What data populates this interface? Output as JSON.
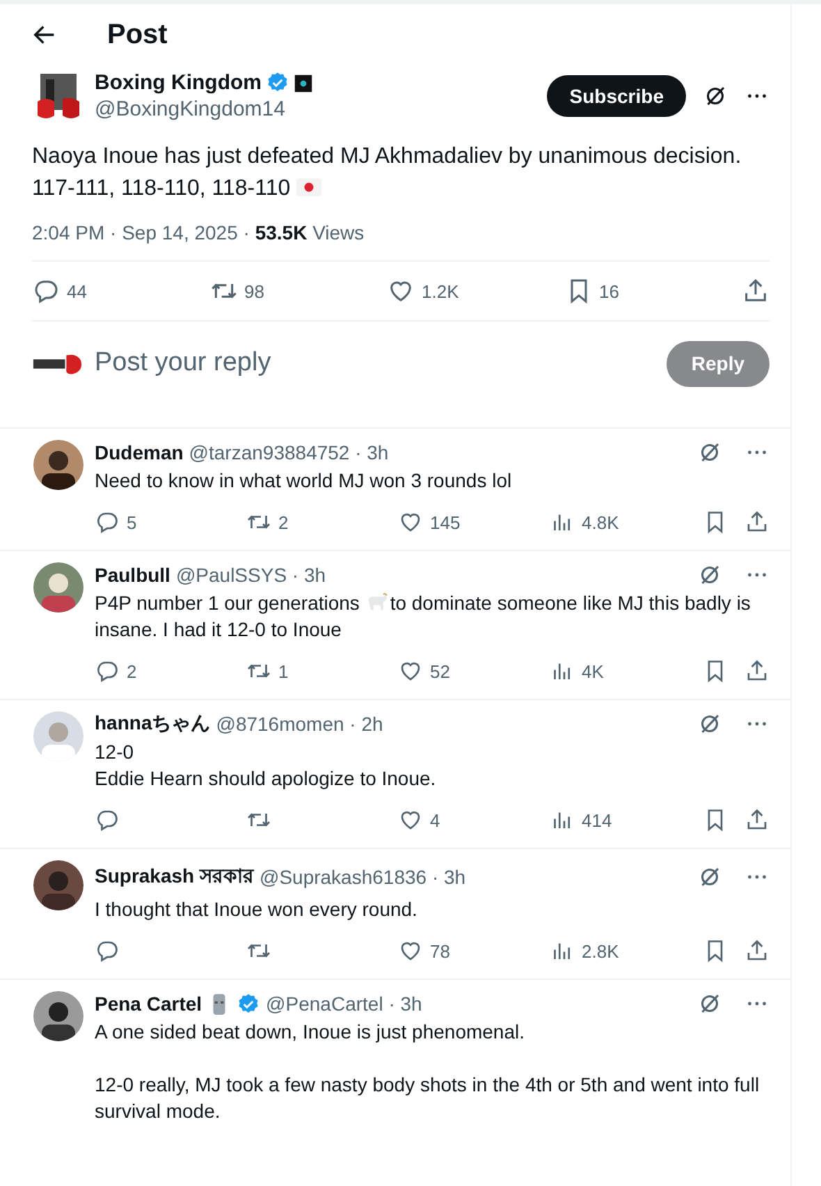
{
  "header": {
    "title": "Post"
  },
  "post": {
    "name": "Boxing Kingdom",
    "badges": [
      {
        "kind": "verified"
      },
      {
        "kind": "affiliate"
      }
    ],
    "handle": "@BoxingKingdom14",
    "subscribe": "Subscribe",
    "body": [
      {
        "kind": "text",
        "text": "Naoya Inoue has just defeated MJ Akhmadaliev by unanimous decision.\n117-111, 118-110, 118-110 "
      },
      {
        "kind": "flag"
      }
    ],
    "time": "2:04 PM · Sep 14, 2025 · ",
    "views": "53.5K",
    "views_label": "Views",
    "actions": [
      {
        "kind": "reply",
        "count": "44"
      },
      {
        "kind": "repost",
        "count": "98"
      },
      {
        "kind": "like",
        "count": "1.2K"
      },
      {
        "kind": "bookmark",
        "count": "16"
      },
      {
        "kind": "share"
      }
    ]
  },
  "composer": {
    "placeholder": "Post your reply",
    "button": "Reply",
    "disabled": true
  },
  "replies": [
    {
      "name": "Dudeman",
      "handle": "@tarzan93884752 · 3h",
      "body": [
        {
          "kind": "text",
          "text": "Need to know in what world MJ won 3 rounds lol"
        }
      ],
      "replies": "5",
      "reposts": "2",
      "likes": "145",
      "views": "4.8K"
    },
    {
      "name": "Paulbull",
      "handle": "@PaulSSYS · 3h",
      "body": [
        {
          "kind": "text",
          "text": "P4P number 1 our generations "
        },
        {
          "kind": "goat"
        },
        {
          "kind": "text",
          "text": "to dominate someone like MJ this badly is insane. I had it 12-0 to Inoue"
        }
      ],
      "replies": "2",
      "reposts": "1",
      "likes": "52",
      "views": "4K"
    },
    {
      "name": "hannaちゃん",
      "handle": "@8716momen · 2h",
      "body": [
        {
          "kind": "text",
          "text": "12-0\nEddie Hearn should apologize to Inoue."
        }
      ],
      "likes": "4",
      "views": "414"
    },
    {
      "name": "Suprakash সরকার",
      "handle": "@Suprakash61836 · 3h",
      "body": [
        {
          "kind": "text",
          "text": "I thought that Inoue won every round."
        }
      ],
      "likes": "78",
      "views": "2.8K"
    },
    {
      "name": "Pena Cartel",
      "badges": [
        {
          "kind": "moai"
        },
        {
          "kind": "verified"
        }
      ],
      "handle": "@PenaCartel · 3h",
      "body": [
        {
          "kind": "text",
          "text": "A one sided beat down, Inoue is just phenomenal.\n\n12-0 really, MJ took a few nasty body shots in the 4th or 5th and went into full survival mode."
        }
      ]
    }
  ]
}
